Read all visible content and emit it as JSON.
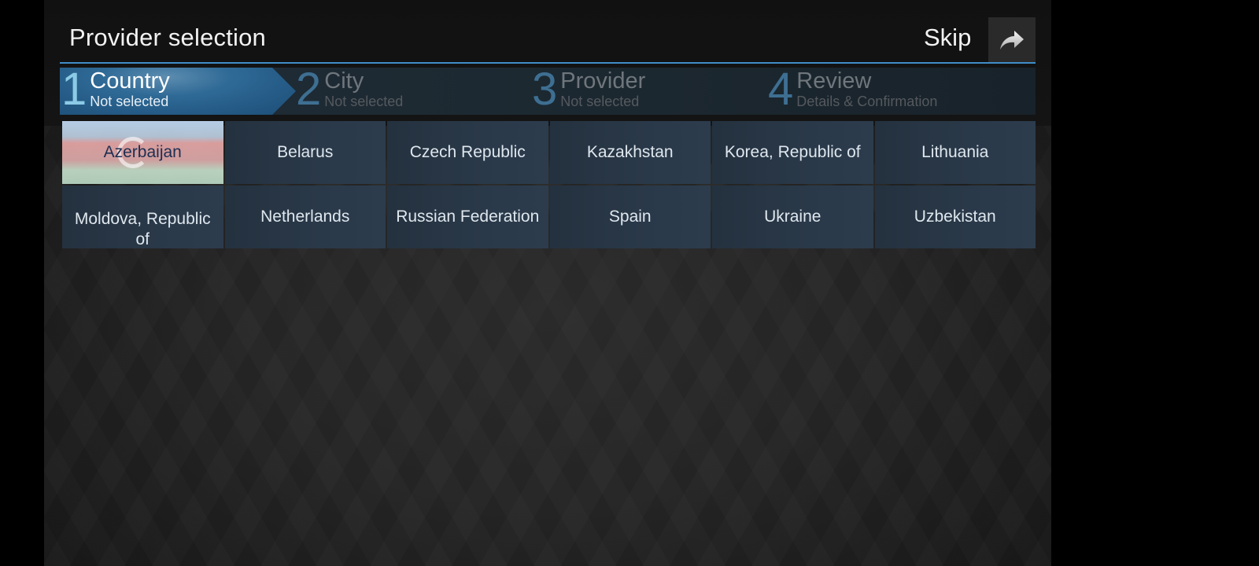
{
  "header": {
    "title": "Provider selection",
    "skip_label": "Skip",
    "skip_icon": "forward-arrow-icon"
  },
  "stepper": {
    "steps": [
      {
        "number": "1",
        "name": "Country",
        "sub": "Not selected",
        "active": true
      },
      {
        "number": "2",
        "name": "City",
        "sub": "Not selected",
        "active": false
      },
      {
        "number": "3",
        "name": "Provider",
        "sub": "Not selected",
        "active": false
      },
      {
        "number": "4",
        "name": "Review",
        "sub": "Details & Confirmation",
        "active": false
      }
    ]
  },
  "countries": [
    {
      "name": "Azerbaijan",
      "highlighted": true
    },
    {
      "name": "Belarus"
    },
    {
      "name": "Czech Republic"
    },
    {
      "name": "Kazakhstan"
    },
    {
      "name": "Korea, Republic of"
    },
    {
      "name": "Lithuania"
    },
    {
      "name": "Moldova, Republic of"
    },
    {
      "name": "Netherlands"
    },
    {
      "name": "Russian Federation"
    },
    {
      "name": "Spain"
    },
    {
      "name": "Ukraine"
    },
    {
      "name": "Uzbekistan"
    }
  ],
  "colors": {
    "accent": "#3f8dc8",
    "active_step": "#2f6a96",
    "cell_bg": "#2a3949"
  }
}
